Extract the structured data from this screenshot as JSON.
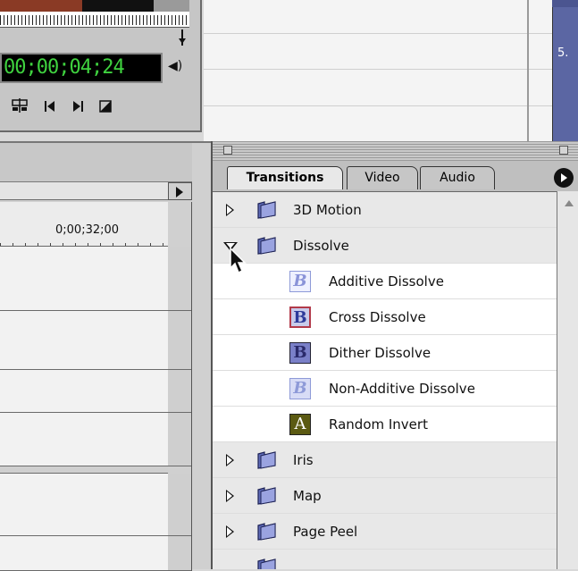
{
  "monitor": {
    "timecode": "00;00;04;24",
    "speaker_icon": "speaker-icon",
    "tools": [
      "ripple-edit-icon",
      "step-back-icon",
      "step-forward-icon",
      "mark-icon"
    ]
  },
  "blue_panel": {
    "text": "5."
  },
  "timeline": {
    "time_label": "0;00;32;00"
  },
  "palette": {
    "tabs": [
      {
        "label": "Transitions",
        "active": true
      },
      {
        "label": "Video",
        "active": false
      },
      {
        "label": "Audio",
        "active": false
      }
    ],
    "rows": [
      {
        "type": "folder",
        "label": "3D Motion",
        "expanded": false
      },
      {
        "type": "folder",
        "label": "Dissolve",
        "expanded": true
      },
      {
        "type": "item",
        "label": "Additive Dissolve",
        "icon_letter": "B",
        "icon": "additive-dissolve-icon"
      },
      {
        "type": "item",
        "label": "Cross Dissolve",
        "icon_letter": "B",
        "icon": "cross-dissolve-icon"
      },
      {
        "type": "item",
        "label": "Dither Dissolve",
        "icon_letter": "B",
        "icon": "dither-dissolve-icon"
      },
      {
        "type": "item",
        "label": "Non-Additive Dissolve",
        "icon_letter": "B",
        "icon": "non-additive-dissolve-icon"
      },
      {
        "type": "item",
        "label": "Random Invert",
        "icon_letter": "A",
        "icon": "random-invert-icon"
      },
      {
        "type": "folder",
        "label": "Iris",
        "expanded": false
      },
      {
        "type": "folder",
        "label": "Map",
        "expanded": false
      },
      {
        "type": "folder",
        "label": "Page Peel",
        "expanded": false
      }
    ]
  },
  "colors": {
    "timecode_green": "#3fd23f",
    "folder_row": "#e8e8e8",
    "blue_panel": "#5b66a3"
  }
}
